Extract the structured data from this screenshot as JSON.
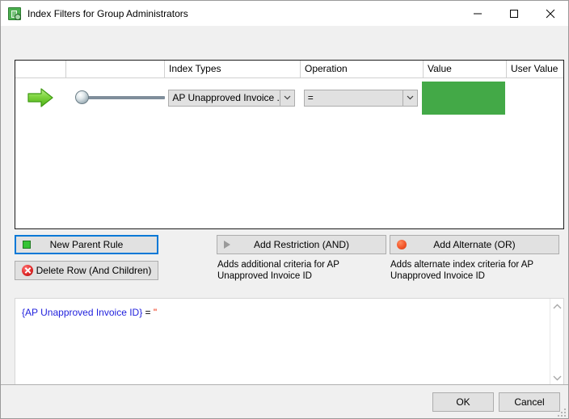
{
  "window": {
    "title": "Index Filters for Group Administrators",
    "icon": "index-filter-icon",
    "minimize_label": "Minimize",
    "maximize_label": "Maximize",
    "close_label": "Close"
  },
  "grid": {
    "columns": [
      {
        "label": "",
        "name": "arrow-column"
      },
      {
        "label": "",
        "name": "slider-column"
      },
      {
        "label": "Index Types",
        "name": "index-types-column"
      },
      {
        "label": "Operation",
        "name": "operation-column"
      },
      {
        "label": "Value",
        "name": "value-column"
      },
      {
        "label": "User Value",
        "name": "user-value-column"
      }
    ],
    "rows": [
      {
        "arrow_icon": "green-right-arrow-icon",
        "slider_value": 0,
        "index_type": "AP Unapproved Invoice ...",
        "operation": "=",
        "value": "",
        "value_color": "#43a947",
        "user_value": ""
      }
    ]
  },
  "actions": {
    "new_parent_rule": "New Parent Rule",
    "delete_row": "Delete Row (And Children)",
    "add_restriction": "Add Restriction (AND)",
    "add_alternate": "Add Alternate (OR)",
    "add_restriction_hint": "Adds additional criteria for AP Unapproved Invoice ID",
    "add_alternate_hint": "Adds alternate index criteria for AP Unapproved Invoice ID"
  },
  "expression": {
    "field": "{AP Unapproved Invoice ID}",
    "operator": " = ",
    "literal": "\""
  },
  "footer": {
    "ok": "OK",
    "cancel": "Cancel"
  },
  "colors": {
    "accent": "#0078d7",
    "value_green": "#43a947",
    "field_token": "#2222dd",
    "literal_token": "#ee2200"
  }
}
